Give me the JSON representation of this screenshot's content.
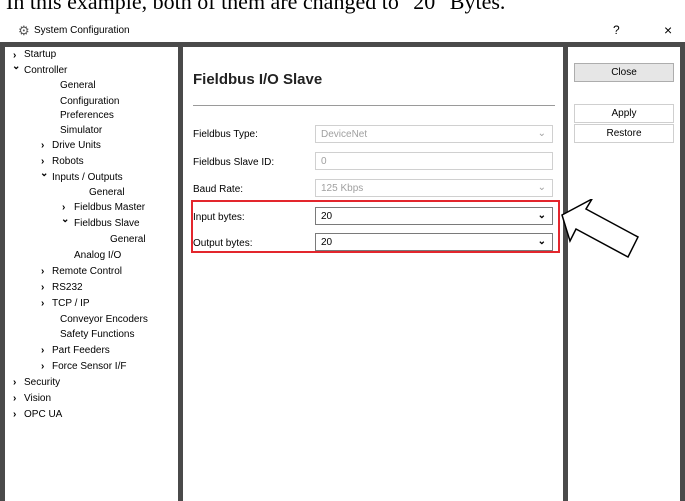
{
  "caption": "In this example, both of them are changed to \"20\" Bytes.",
  "window": {
    "title": "System Configuration",
    "icon": "gear-icon",
    "help_label": "?",
    "close_label": "×"
  },
  "tree": {
    "startup": "Startup",
    "controller": "Controller",
    "general": "General",
    "configuration": "Configuration",
    "preferences": "Preferences",
    "simulator": "Simulator",
    "drive_units": "Drive Units",
    "robots": "Robots",
    "inputs_outputs": "Inputs / Outputs",
    "io_general": "General",
    "fieldbus_master": "Fieldbus Master",
    "fieldbus_slave": "Fieldbus Slave",
    "fs_general": "General",
    "analog_io": "Analog I/O",
    "remote_control": "Remote Control",
    "rs232": "RS232",
    "tcp_ip": "TCP / IP",
    "conveyor_encoders": "Conveyor Encoders",
    "safety_functions": "Safety Functions",
    "part_feeders": "Part Feeders",
    "force_sensor": "Force Sensor I/F",
    "security": "Security",
    "vision": "Vision",
    "opc_ua": "OPC UA"
  },
  "panel": {
    "heading": "Fieldbus I/O Slave",
    "fieldbus_type_label": "Fieldbus Type:",
    "fieldbus_type_value": "DeviceNet",
    "slave_id_label": "Fieldbus Slave ID:",
    "slave_id_value": "0",
    "baud_rate_label": "Baud Rate:",
    "baud_rate_value": "125 Kbps",
    "input_bytes_label": "Input bytes:",
    "input_bytes_value": "20",
    "output_bytes_label": "Output bytes:",
    "output_bytes_value": "20"
  },
  "buttons": {
    "close": "Close",
    "apply": "Apply",
    "restore": "Restore"
  },
  "colors": {
    "highlight": "#e3262d",
    "frame": "#4a4a4a"
  }
}
